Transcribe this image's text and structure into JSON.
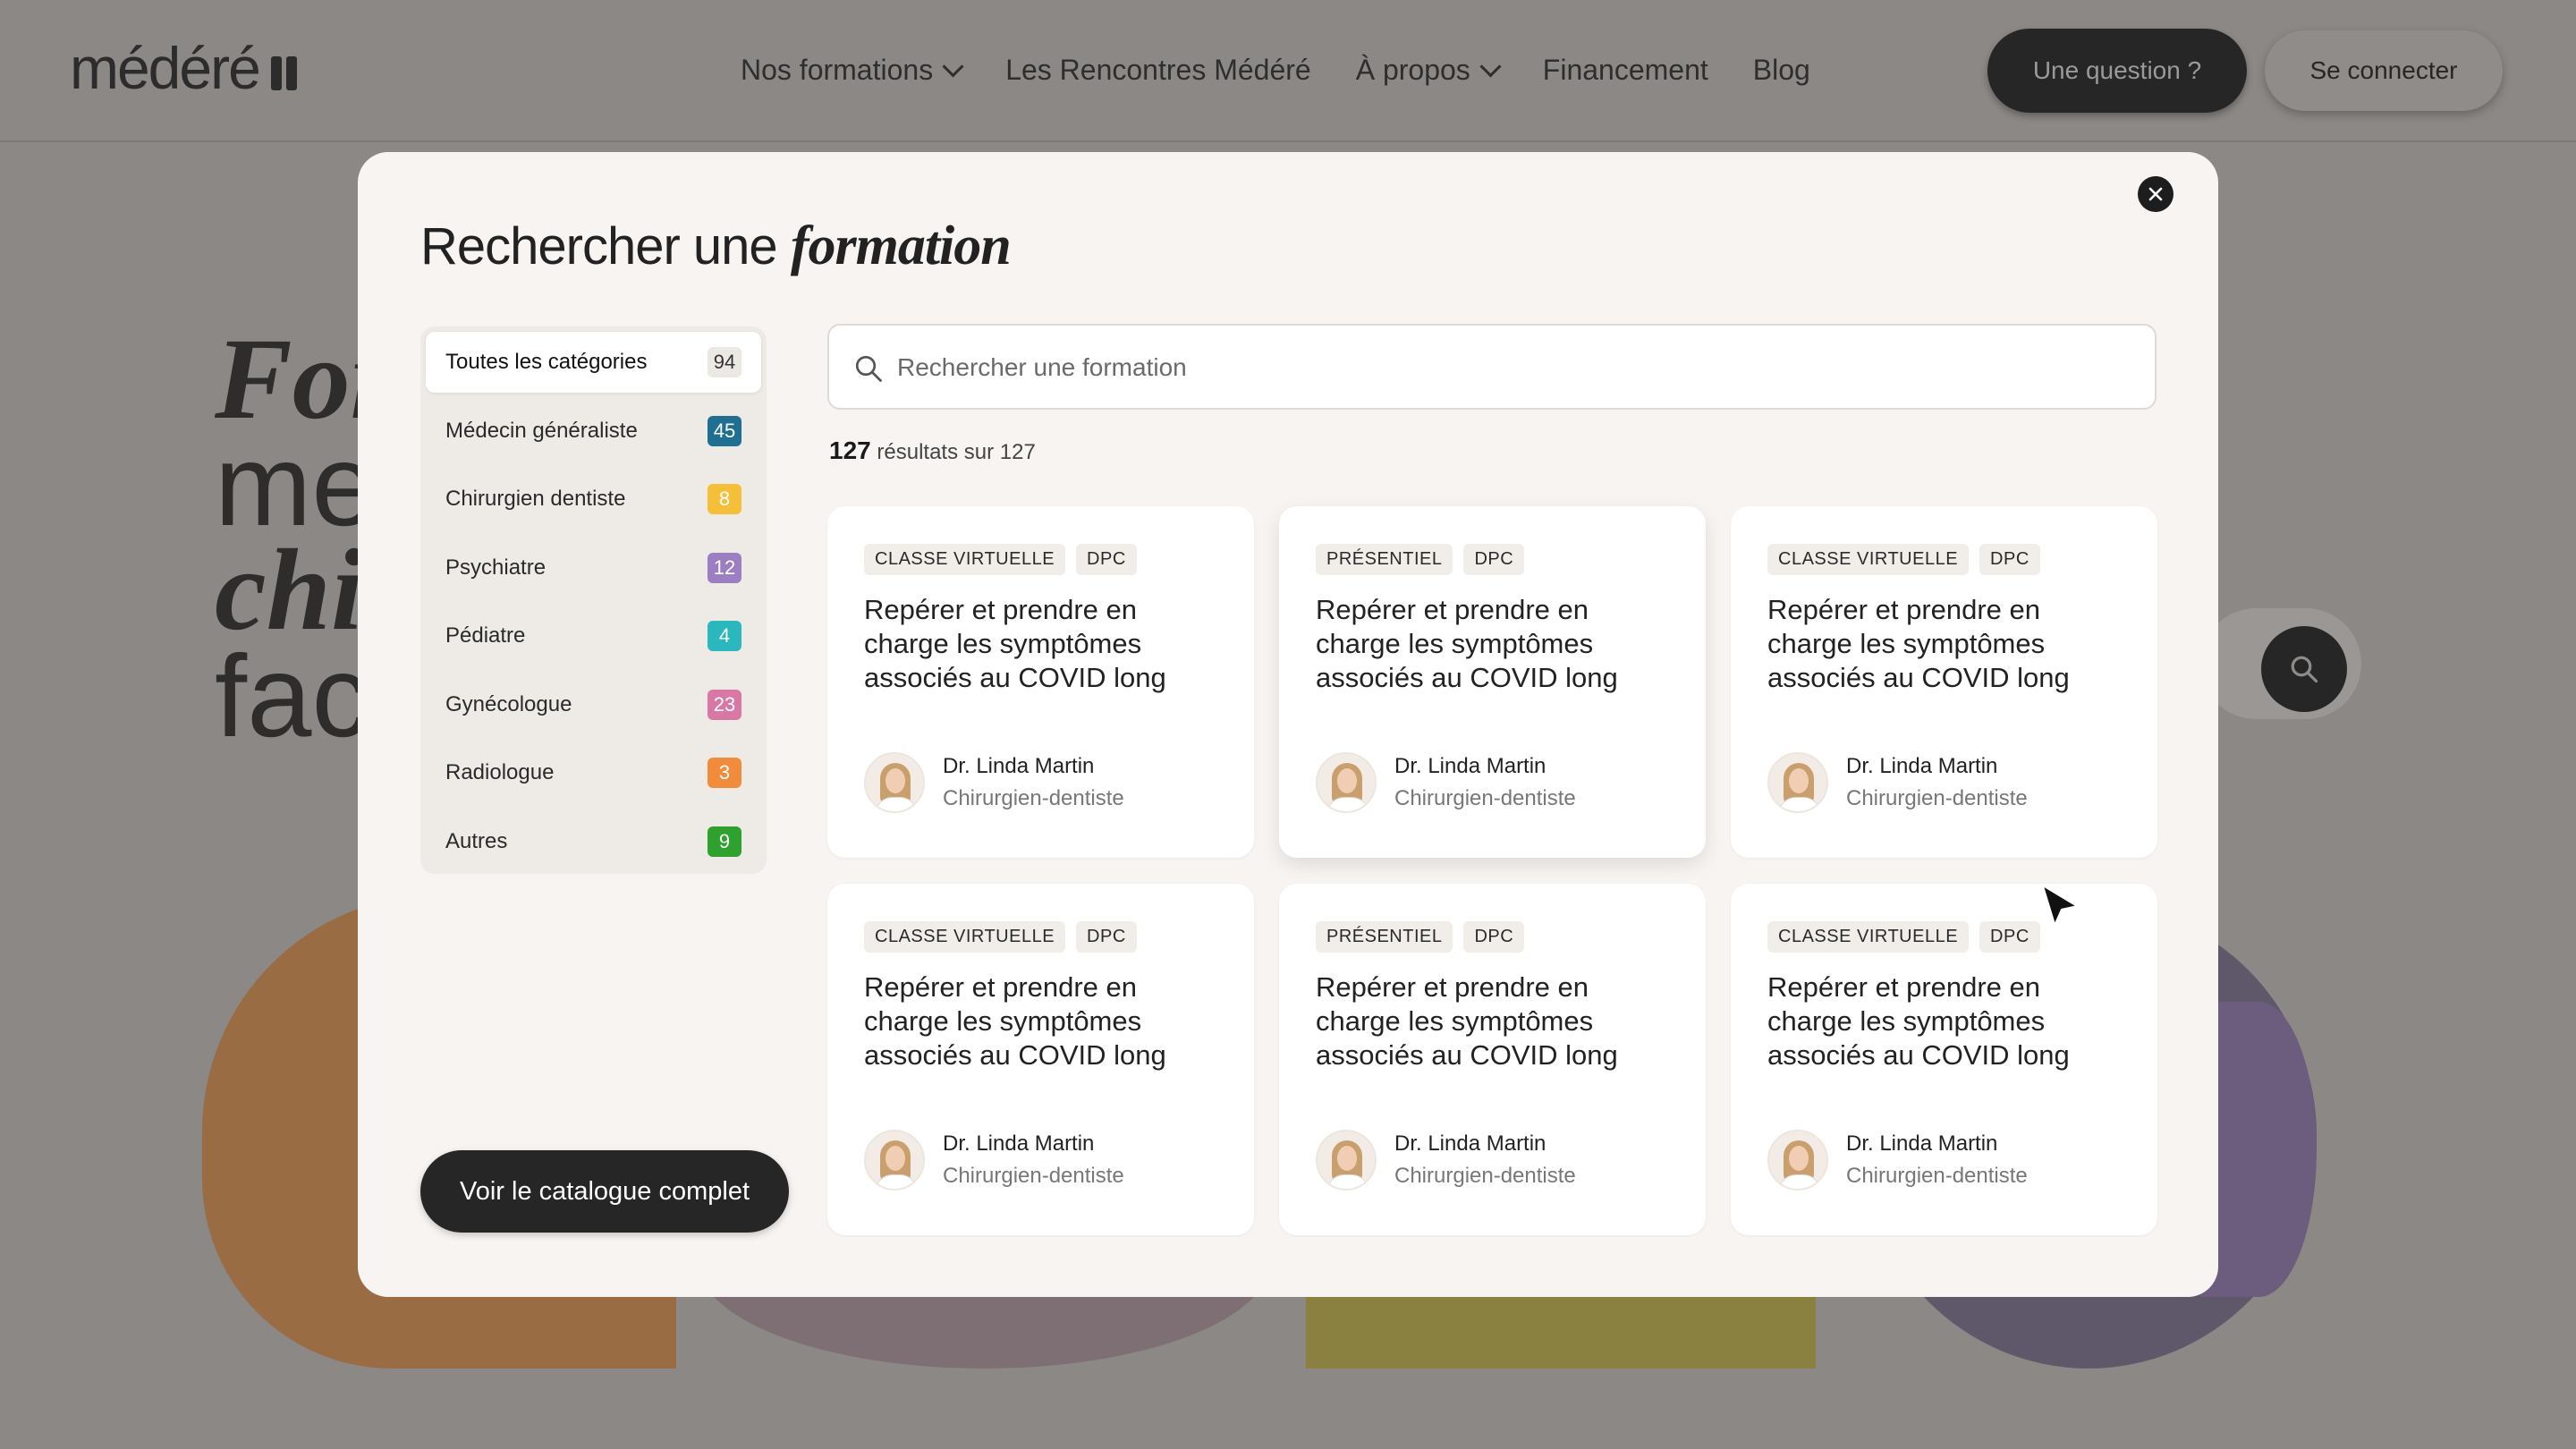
{
  "header": {
    "logo_text": "médéré",
    "nav": [
      {
        "label": "Nos formations",
        "has_dropdown": true
      },
      {
        "label": "Les Rencontres Médéré",
        "has_dropdown": false
      },
      {
        "label": "À propos",
        "has_dropdown": true
      },
      {
        "label": "Financement",
        "has_dropdown": false
      },
      {
        "label": "Blog",
        "has_dropdown": false
      }
    ],
    "question_button": "Une question ?",
    "login_button": "Se connecter"
  },
  "hero": {
    "line1": "For",
    "line2": "me",
    "line3": "chi",
    "line4": "fac"
  },
  "modal": {
    "title_regular": "Rechercher une",
    "title_emphasis": "formation",
    "search": {
      "placeholder": "Rechercher une formation",
      "value": ""
    },
    "results": {
      "shown": "127",
      "text": "résultats sur 127"
    },
    "catalog_button": "Voir le catalogue complet",
    "categories": [
      {
        "label": "Toutes les catégories",
        "count": "94",
        "color": "#ece8e3",
        "active": true
      },
      {
        "label": "Médecin généraliste",
        "count": "45",
        "color": "#1f6f93",
        "active": false
      },
      {
        "label": "Chirurgien dentiste",
        "count": "8",
        "color": "#f5bf3a",
        "active": false
      },
      {
        "label": "Psychiatre",
        "count": "12",
        "color": "#9b7fc2",
        "active": false
      },
      {
        "label": "Pédiatre",
        "count": "4",
        "color": "#2ab7bd",
        "active": false
      },
      {
        "label": "Gynécologue",
        "count": "23",
        "color": "#d978a4",
        "active": false
      },
      {
        "label": "Radiologue",
        "count": "3",
        "color": "#f08c3b",
        "active": false
      },
      {
        "label": "Autres",
        "count": "9",
        "color": "#2fa12f",
        "active": false
      }
    ],
    "cards": [
      {
        "tags": [
          "CLASSE VIRTUELLE",
          "DPC"
        ],
        "title": "Repérer et prendre en charge les symptômes associés au COVID long",
        "author": "Dr. Linda Martin",
        "role": "Chirurgien-dentiste"
      },
      {
        "tags": [
          "PRÉSENTIEL",
          "DPC"
        ],
        "title": "Repérer et prendre en charge les symptômes associés au COVID long",
        "author": "Dr. Linda Martin",
        "role": "Chirurgien-dentiste"
      },
      {
        "tags": [
          "CLASSE VIRTUELLE",
          "DPC"
        ],
        "title": "Repérer et prendre en charge les symptômes associés au COVID long",
        "author": "Dr. Linda Martin",
        "role": "Chirurgien-dentiste"
      },
      {
        "tags": [
          "CLASSE VIRTUELLE",
          "DPC"
        ],
        "title": "Repérer et prendre en charge les symptômes associés au COVID long",
        "author": "Dr. Linda Martin",
        "role": "Chirurgien-dentiste"
      },
      {
        "tags": [
          "PRÉSENTIEL",
          "DPC"
        ],
        "title": "Repérer et prendre en charge les symptômes associés au COVID long",
        "author": "Dr. Linda Martin",
        "role": "Chirurgien-dentiste"
      },
      {
        "tags": [
          "CLASSE VIRTUELLE",
          "DPC"
        ],
        "title": "Repérer et prendre en charge les symptômes associés au COVID long",
        "author": "Dr. Linda Martin",
        "role": "Chirurgien-dentiste"
      }
    ]
  },
  "icons": {
    "close": "close-icon",
    "search": "search-icon",
    "cursor": "mouse-pointer-icon"
  }
}
